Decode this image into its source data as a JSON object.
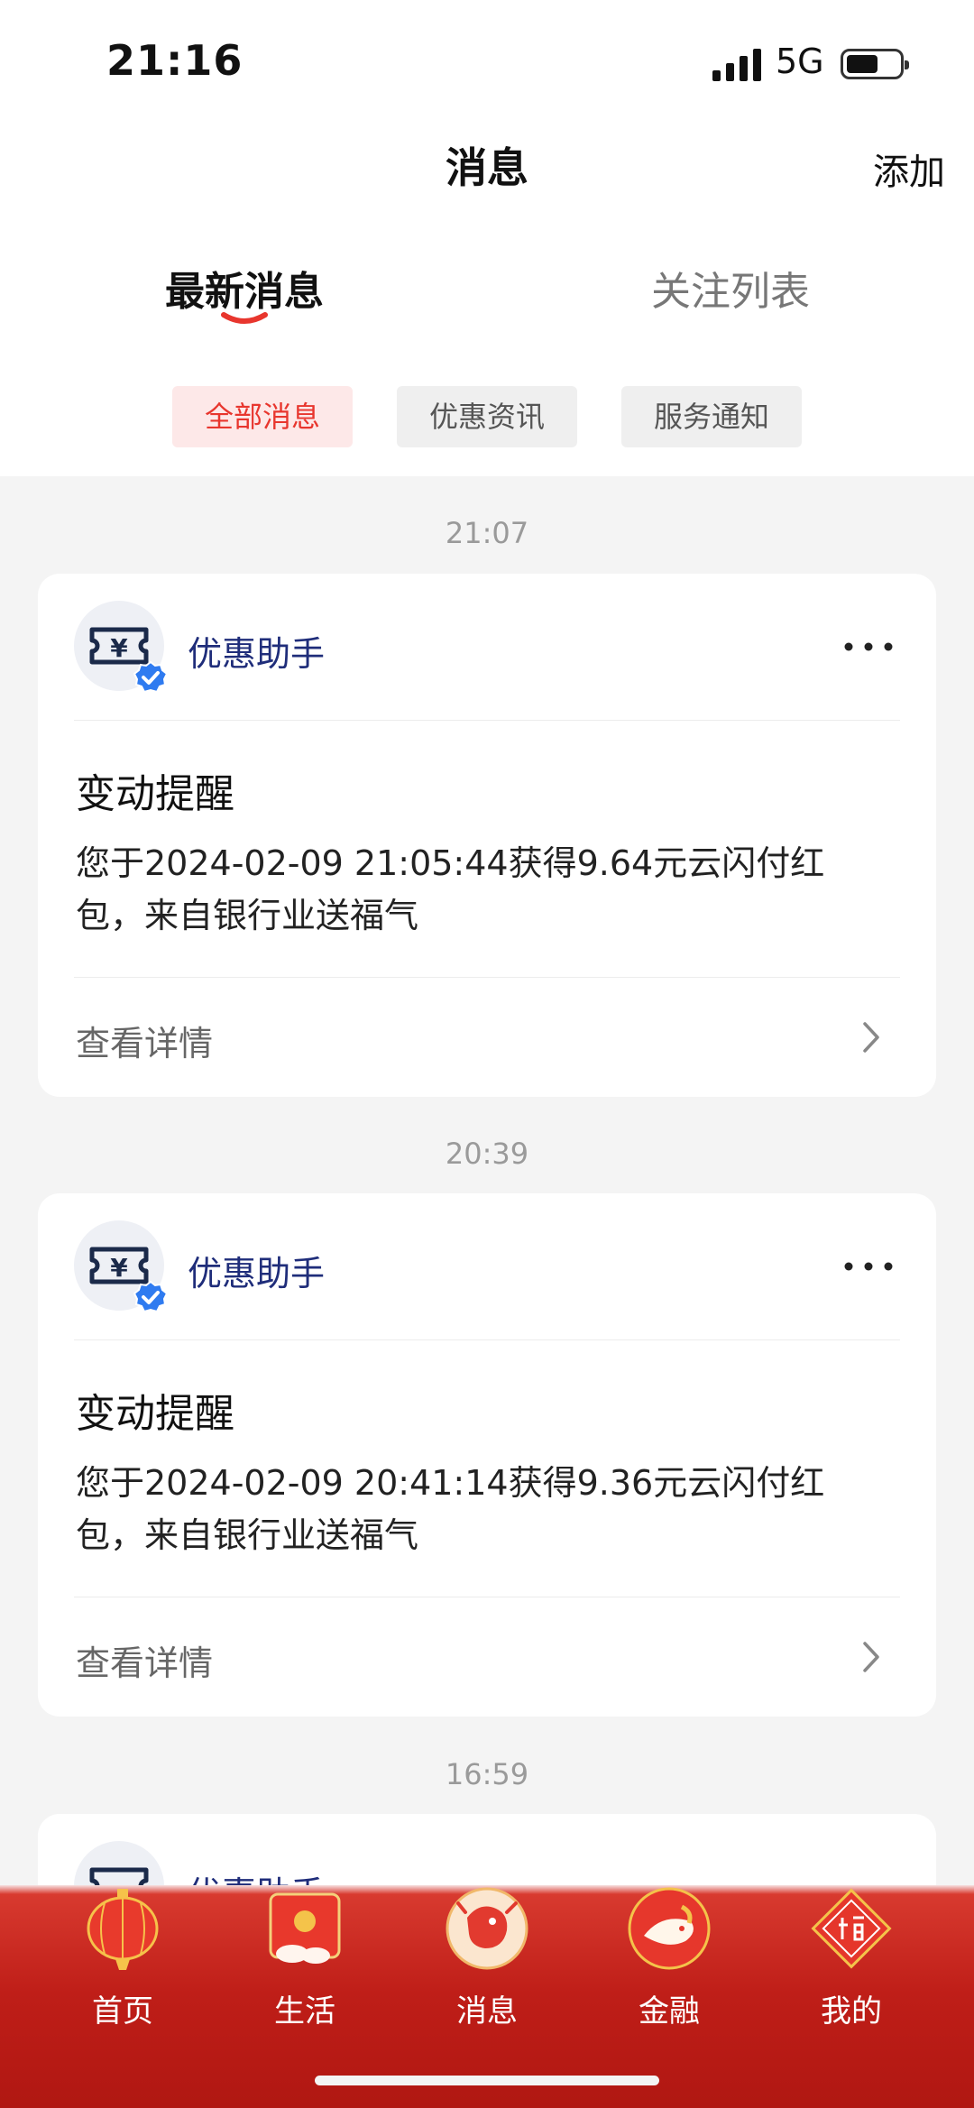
{
  "status_bar": {
    "time": "21:16",
    "network": "5G"
  },
  "header": {
    "title": "消息",
    "add_label": "添加"
  },
  "tabs": [
    {
      "label": "最新消息",
      "active": true
    },
    {
      "label": "关注列表",
      "active": false
    }
  ],
  "filters": [
    {
      "label": "全部消息",
      "active": true
    },
    {
      "label": "优惠资讯",
      "active": false
    },
    {
      "label": "服务通知",
      "active": false
    }
  ],
  "feed": [
    {
      "time": "21:07",
      "sender": "优惠助手",
      "title": "变动提醒",
      "body": "您于2024-02-09 21:05:44获得9.64元云闪付红包，来自银行业送福气",
      "detail_label": "查看详情"
    },
    {
      "time": "20:39",
      "sender": "优惠助手",
      "title": "变动提醒",
      "body": "您于2024-02-09 20:41:14获得9.36元云闪付红包，来自银行业送福气",
      "detail_label": "查看详情"
    },
    {
      "time": "16:59",
      "sender": "优惠助手"
    }
  ],
  "bottom_nav": [
    {
      "label": "首页",
      "icon": "lantern-icon"
    },
    {
      "label": "生活",
      "icon": "red-envelope-icon"
    },
    {
      "label": "消息",
      "icon": "dragon-icon",
      "active": true
    },
    {
      "label": "金融",
      "icon": "koi-icon"
    },
    {
      "label": "我的",
      "icon": "fu-icon"
    }
  ],
  "colors": {
    "accent": "#e8362e",
    "sender": "#1f2d7a",
    "nav_bg": "#c4201a"
  }
}
